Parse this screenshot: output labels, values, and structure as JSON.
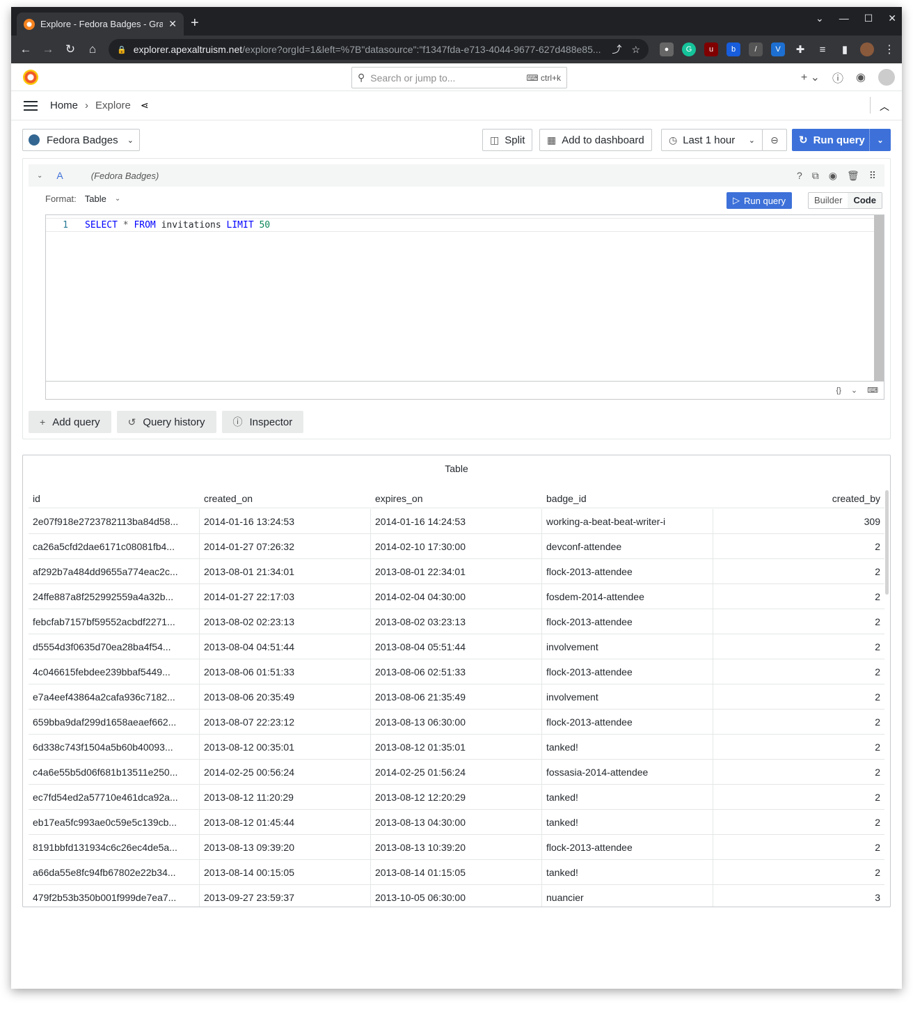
{
  "browser": {
    "tab_title": "Explore - Fedora Badges - Grafana",
    "url_host": "explorer.apexaltruism.net",
    "url_path": "/explore?orgId=1&left=%7B\"datasource\":\"f1347fda-e713-4044-9677-627d488e85..."
  },
  "topnav": {
    "search_placeholder": "Search or jump to...",
    "search_shortcut": "ctrl+k"
  },
  "breadcrumb": {
    "home": "Home",
    "current": "Explore"
  },
  "explore_toolbar": {
    "datasource": "Fedora Badges",
    "split_label": "Split",
    "add_dashboard_label": "Add to dashboard",
    "time_range": "Last 1 hour",
    "run_query_label": "Run query"
  },
  "query": {
    "ref_id": "A",
    "datasource_note": "(Fedora Badges)",
    "format_label": "Format:",
    "format_value": "Table",
    "run_label": "Run query",
    "builder_label": "Builder",
    "code_label": "Code",
    "line_number": "1",
    "sql": {
      "select": "SELECT",
      "star": "*",
      "from": "FROM",
      "table": "invitations",
      "limit": "LIMIT",
      "limit_value": "50"
    },
    "actions": {
      "add_query": "Add query",
      "history": "Query history",
      "inspector": "Inspector"
    }
  },
  "table": {
    "title": "Table",
    "columns": [
      "id",
      "created_on",
      "expires_on",
      "badge_id",
      "created_by"
    ],
    "rows": [
      [
        "2e07f918e2723782113ba84d58...",
        "2014-01-16 13:24:53",
        "2014-01-16 14:24:53",
        "working-a-beat-beat-writer-i",
        "309"
      ],
      [
        "ca26a5cfd2dae6171c08081fb4...",
        "2014-01-27 07:26:32",
        "2014-02-10 17:30:00",
        "devconf-attendee",
        "2"
      ],
      [
        "af292b7a484dd9655a774eac2c...",
        "2013-08-01 21:34:01",
        "2013-08-01 22:34:01",
        "flock-2013-attendee",
        "2"
      ],
      [
        "24ffe887a8f252992559a4a32b...",
        "2014-01-27 22:17:03",
        "2014-02-04 04:30:00",
        "fosdem-2014-attendee",
        "2"
      ],
      [
        "febcfab7157bf59552acbdf2271...",
        "2013-08-02 02:23:13",
        "2013-08-02 03:23:13",
        "flock-2013-attendee",
        "2"
      ],
      [
        "d5554d3f0635d70ea28ba4f54...",
        "2013-08-04 04:51:44",
        "2013-08-04 05:51:44",
        "involvement",
        "2"
      ],
      [
        "4c046615febdee239bbaf5449...",
        "2013-08-06 01:51:33",
        "2013-08-06 02:51:33",
        "flock-2013-attendee",
        "2"
      ],
      [
        "e7a4eef43864a2cafa936c7182...",
        "2013-08-06 20:35:49",
        "2013-08-06 21:35:49",
        "involvement",
        "2"
      ],
      [
        "659bba9daf299d1658aeaef662...",
        "2013-08-07 22:23:12",
        "2013-08-13 06:30:00",
        "flock-2013-attendee",
        "2"
      ],
      [
        "6d338c743f1504a5b60b40093...",
        "2013-08-12 00:35:01",
        "2013-08-12 01:35:01",
        "tanked!",
        "2"
      ],
      [
        "c4a6e55b5d06f681b13511e250...",
        "2014-02-25 00:56:24",
        "2014-02-25 01:56:24",
        "fossasia-2014-attendee",
        "2"
      ],
      [
        "ec7fd54ed2a57710e461dca92a...",
        "2013-08-12 11:20:29",
        "2013-08-12 12:20:29",
        "tanked!",
        "2"
      ],
      [
        "eb17ea5fc993ae0c59e5c139cb...",
        "2013-08-12 01:45:44",
        "2013-08-13 04:30:00",
        "tanked!",
        "2"
      ],
      [
        "8191bbfd131934c6c26ec4de5a...",
        "2013-08-13 09:39:20",
        "2013-08-13 10:39:20",
        "flock-2013-attendee",
        "2"
      ],
      [
        "a66da55e8fc94fb67802e22b34...",
        "2013-08-14 00:15:05",
        "2013-08-14 01:15:05",
        "tanked!",
        "2"
      ],
      [
        "479f2b53b350b001f999de7ea7...",
        "2013-09-27 23:59:37",
        "2013-10-05 06:30:00",
        "nuancier",
        "3"
      ]
    ]
  }
}
